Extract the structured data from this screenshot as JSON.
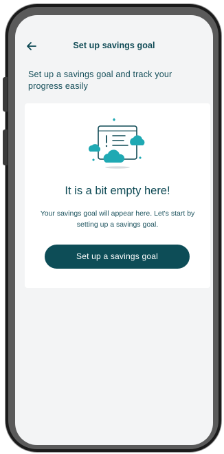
{
  "header": {
    "title": "Set up savings goal",
    "back_icon": "arrow-left-icon"
  },
  "intro": {
    "text": "Set up a savings goal and track your progress easily"
  },
  "empty_state": {
    "illustration_icon": "document-with-clouds-icon",
    "title": "It is a bit empty here!",
    "message": "Your savings goal will appear here. Let's start by setting up a savings goal.",
    "button_label": "Set up a savings goal"
  },
  "colors": {
    "primary": "#0d4d57",
    "accent_teal": "#1fa9b3",
    "background": "#f3f4f5",
    "card": "#ffffff"
  }
}
